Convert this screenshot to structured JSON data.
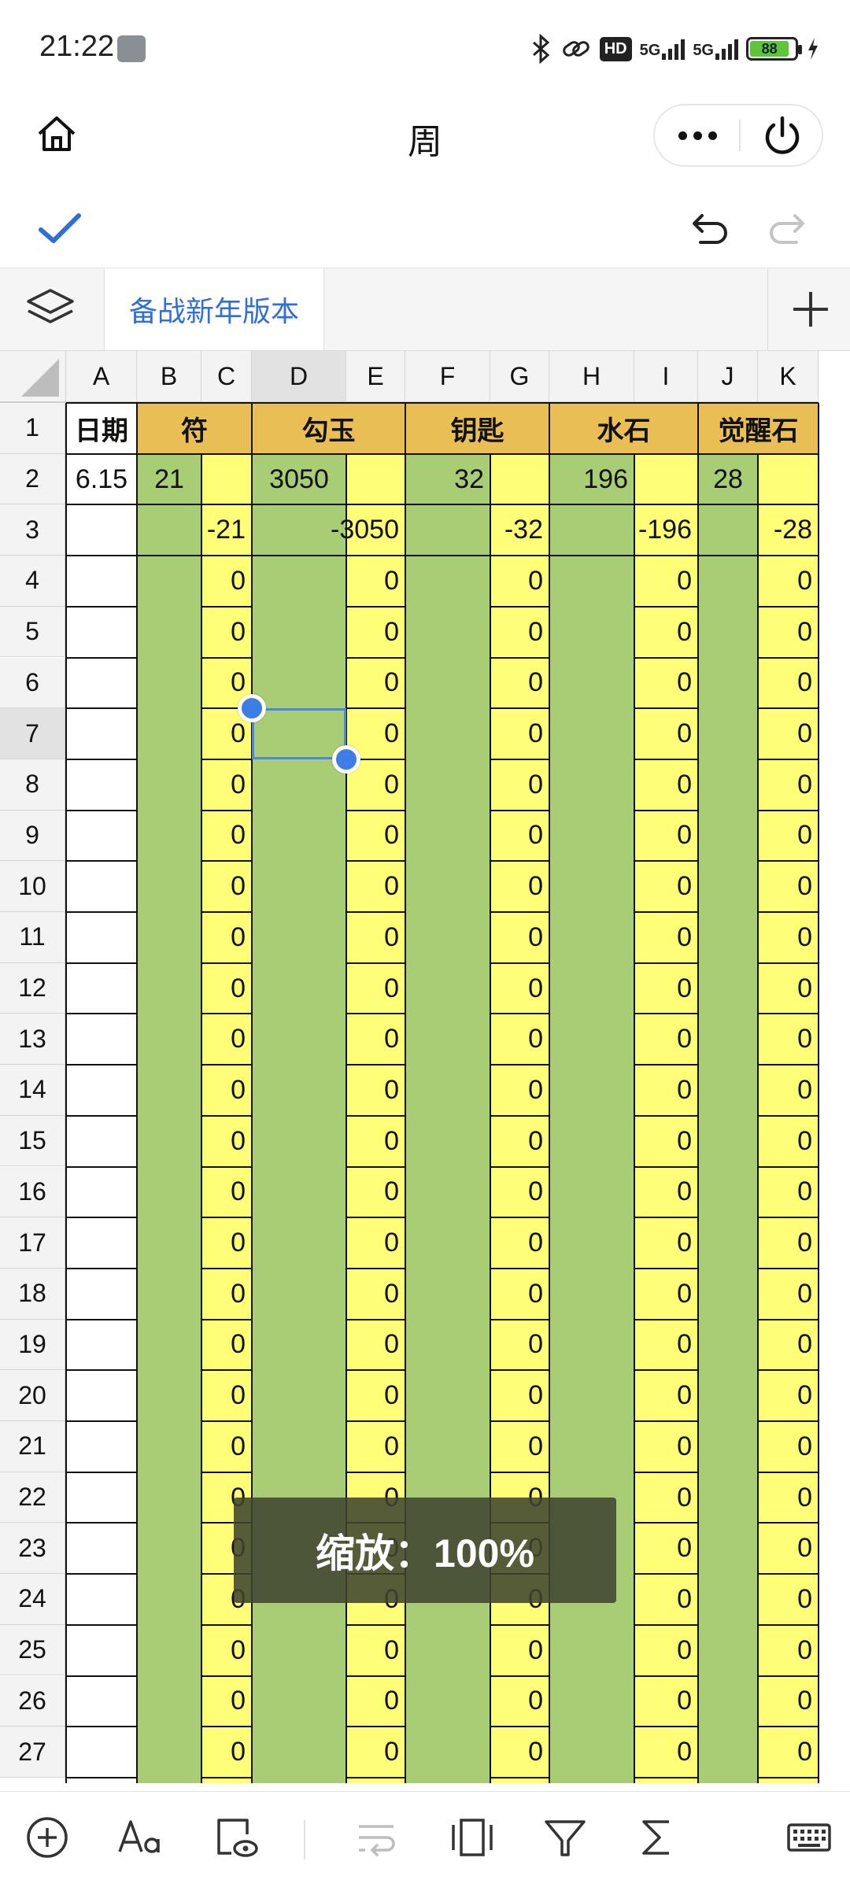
{
  "status_bar": {
    "time": "21:22",
    "battery": "88",
    "net1": "5G",
    "net2": "5G",
    "hd": "HD"
  },
  "header": {
    "title": "周"
  },
  "tabs": {
    "active_sheet": "备战新年版本"
  },
  "grid": {
    "columns": [
      "A",
      "B",
      "C",
      "D",
      "E",
      "F",
      "G",
      "H",
      "I",
      "J",
      "K"
    ],
    "selected_column": "D",
    "selected_row": 7,
    "rows": [
      "1",
      "2",
      "3",
      "4",
      "5",
      "6",
      "7",
      "8",
      "9",
      "10",
      "11",
      "12",
      "13",
      "14",
      "15",
      "16",
      "17",
      "18",
      "19",
      "20",
      "21",
      "22",
      "23",
      "24",
      "25",
      "26",
      "27"
    ],
    "header_row": {
      "A": "日期",
      "BC": "符",
      "DE": "勾玉",
      "FG": "钥匙",
      "HI": "水石",
      "JK": "觉醒石"
    },
    "row2": {
      "A": "6.15",
      "B": "21",
      "D": "3050",
      "F": "32",
      "H": "196",
      "J": "28"
    },
    "row3": {
      "C": "-21",
      "E": "-3050",
      "G": "-32",
      "I": "-196",
      "K": "-28"
    },
    "zero_value": "0"
  },
  "zoom_toast": "缩放：100%",
  "colors": {
    "green": "#a9cd74",
    "yellow": "#ffff77",
    "orange": "#e9bf55",
    "accent": "#2f6fd6",
    "selection": "#4a86e8"
  },
  "bottom_toolbar": [
    "add-icon",
    "text-format-icon",
    "cell-style-icon",
    "wrap-icon",
    "freeze-icon",
    "filter-icon",
    "sum-icon",
    "keyboard-icon"
  ]
}
